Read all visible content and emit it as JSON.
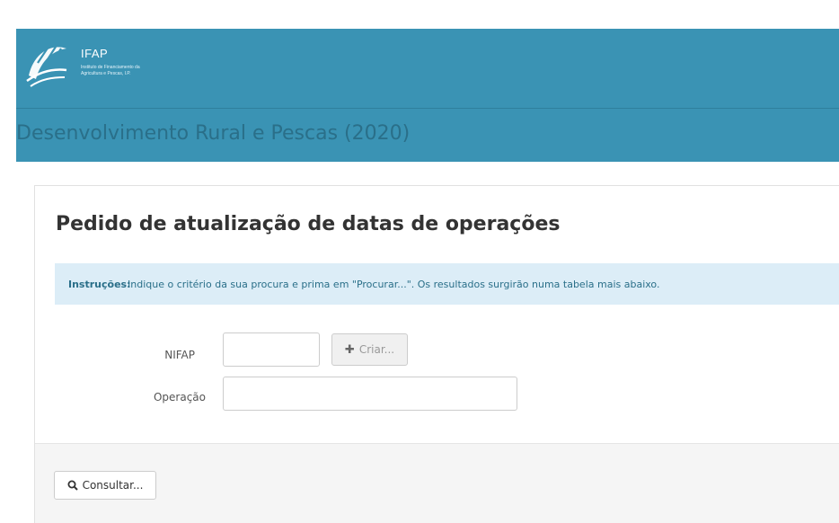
{
  "header": {
    "logo": {
      "title": "IFAP",
      "subtitle": "Instituto de Financiamento da Agricultura e Pescas, I.P."
    },
    "site_title": "Desenvolvimento Rural e Pescas (2020)",
    "colors": {
      "bar": "#3a93b4",
      "title_text": "#2a6f89"
    }
  },
  "page": {
    "title": "Pedido de atualização de datas de operações",
    "instructions": {
      "label": "Instruções:",
      "text": "Indique o critério da sua procura e prima em \"Procurar...\". Os resultados surgirão numa tabela mais abaixo."
    }
  },
  "form": {
    "nifap": {
      "label": "NIFAP",
      "value": ""
    },
    "criar_button": {
      "icon": "plus-icon",
      "label": "Criar..."
    },
    "operacao": {
      "label": "Operação",
      "value": ""
    }
  },
  "footer": {
    "consultar_button": {
      "icon": "search-icon",
      "label": "Consultar..."
    }
  }
}
